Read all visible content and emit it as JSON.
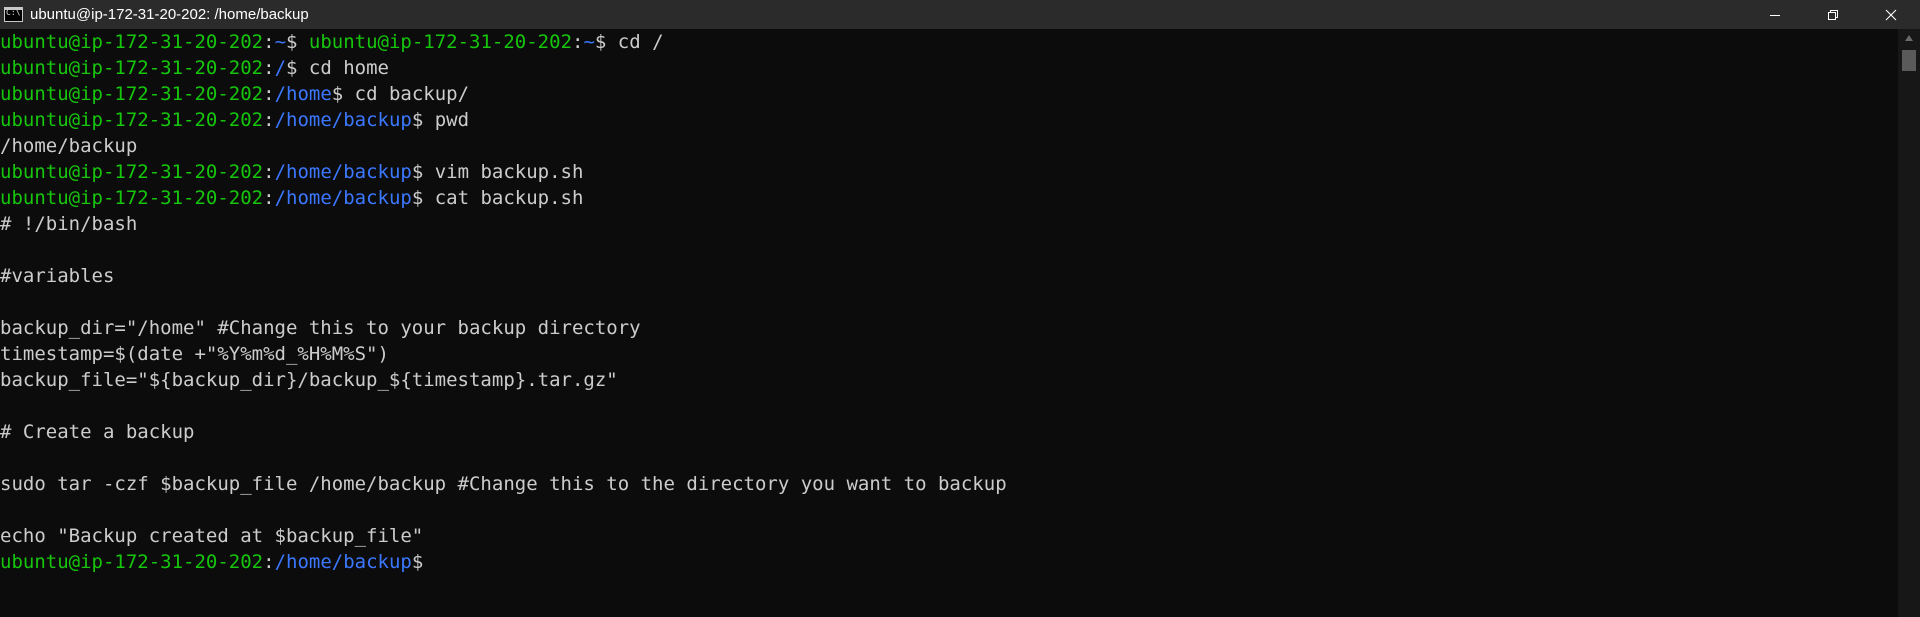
{
  "window": {
    "title": "ubuntu@ip-172-31-20-202: /home/backup"
  },
  "icons": {
    "app": "cmd-terminal-icon",
    "minimize": "minimize-icon",
    "maximize": "restore-icon",
    "close": "close-icon",
    "scroll_up": "chevron-up-icon"
  },
  "colors": {
    "background": "#0c0c0c",
    "titlebar": "#2b2b2b",
    "user_host": "#16c60c",
    "path": "#3b78ff",
    "text": "#cccccc"
  },
  "terminal": {
    "lines": [
      [
        {
          "s": "u",
          "t": "ubuntu@ip-172-31-20-202"
        },
        {
          "s": "t",
          "t": ":"
        },
        {
          "s": "p",
          "t": "~"
        },
        {
          "s": "t",
          "t": "$ "
        },
        {
          "s": "u",
          "t": "ubuntu@ip-172-31-20-202"
        },
        {
          "s": "t",
          "t": ":"
        },
        {
          "s": "p",
          "t": "~"
        },
        {
          "s": "t",
          "t": "$ cd /"
        }
      ],
      [
        {
          "s": "u",
          "t": "ubuntu@ip-172-31-20-202"
        },
        {
          "s": "t",
          "t": ":"
        },
        {
          "s": "p",
          "t": "/"
        },
        {
          "s": "t",
          "t": "$ cd home"
        }
      ],
      [
        {
          "s": "u",
          "t": "ubuntu@ip-172-31-20-202"
        },
        {
          "s": "t",
          "t": ":"
        },
        {
          "s": "p",
          "t": "/home"
        },
        {
          "s": "t",
          "t": "$ cd backup/"
        }
      ],
      [
        {
          "s": "u",
          "t": "ubuntu@ip-172-31-20-202"
        },
        {
          "s": "t",
          "t": ":"
        },
        {
          "s": "p",
          "t": "/home/backup"
        },
        {
          "s": "t",
          "t": "$ pwd"
        }
      ],
      [
        {
          "s": "t",
          "t": "/home/backup"
        }
      ],
      [
        {
          "s": "u",
          "t": "ubuntu@ip-172-31-20-202"
        },
        {
          "s": "t",
          "t": ":"
        },
        {
          "s": "p",
          "t": "/home/backup"
        },
        {
          "s": "t",
          "t": "$ vim backup.sh"
        }
      ],
      [
        {
          "s": "u",
          "t": "ubuntu@ip-172-31-20-202"
        },
        {
          "s": "t",
          "t": ":"
        },
        {
          "s": "p",
          "t": "/home/backup"
        },
        {
          "s": "t",
          "t": "$ cat backup.sh"
        }
      ],
      [
        {
          "s": "t",
          "t": "# !/bin/bash"
        }
      ],
      [],
      [
        {
          "s": "t",
          "t": "#variables"
        }
      ],
      [],
      [
        {
          "s": "t",
          "t": "backup_dir=\"/home\" #Change this to your backup directory"
        }
      ],
      [
        {
          "s": "t",
          "t": "timestamp=$(date +\"%Y%m%d_%H%M%S\")"
        }
      ],
      [
        {
          "s": "t",
          "t": "backup_file=\"${backup_dir}/backup_${timestamp}.tar.gz\""
        }
      ],
      [],
      [
        {
          "s": "t",
          "t": "# Create a backup"
        }
      ],
      [],
      [
        {
          "s": "t",
          "t": "sudo tar -czf $backup_file /home/backup #Change this to the directory you want to backup"
        }
      ],
      [],
      [
        {
          "s": "t",
          "t": "echo \"Backup created at $backup_file\""
        }
      ],
      [
        {
          "s": "u",
          "t": "ubuntu@ip-172-31-20-202"
        },
        {
          "s": "t",
          "t": ":"
        },
        {
          "s": "p",
          "t": "/home/backup"
        },
        {
          "s": "t",
          "t": "$"
        }
      ]
    ]
  }
}
